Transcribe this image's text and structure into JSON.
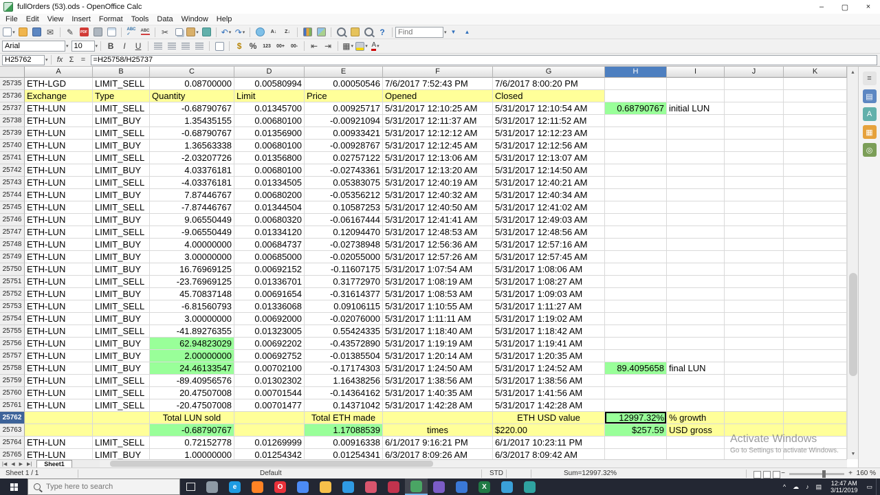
{
  "window": {
    "title": "fullOrders (53).ods - OpenOffice Calc"
  },
  "menubar": [
    "File",
    "Edit",
    "View",
    "Insert",
    "Format",
    "Tools",
    "Data",
    "Window",
    "Help"
  ],
  "standard_toolbar": {
    "find_placeholder": "Find"
  },
  "formatting_toolbar": {
    "font_name": "Arial",
    "font_size": "10"
  },
  "formula_bar": {
    "name_box": "H25762",
    "formula": "=H25758/H25737"
  },
  "colors": {
    "header_yellow": "#ffff99",
    "highlight_green": "#99ff99",
    "selected_header_blue": "#4d7fc0",
    "selection_border": "#000000",
    "taskbar": "#232733"
  },
  "sheet": {
    "columns": [
      "A",
      "B",
      "C",
      "D",
      "E",
      "F",
      "G",
      "H",
      "I",
      "J",
      "K"
    ],
    "selected_cell": {
      "row": "25762",
      "col": "H"
    },
    "left_rows": [
      "25736"
    ],
    "center_cells": [
      "25762:C",
      "25762:E",
      "25762:G",
      "25763:F"
    ],
    "green_cells": [
      "25737:H",
      "25756:C",
      "25757:C",
      "25758:C",
      "25758:H",
      "25762:H",
      "25763:C",
      "25763:E",
      "25763:H"
    ],
    "yellow": {
      "25736": "ABCDEFG",
      "25762": "ABCDEFGHIJK",
      "25763": "ABCDEFGHIJK"
    },
    "rows": [
      {
        "n": "25735",
        "c": [
          "ETH-LGD",
          "LIMIT_SELL",
          "0.08700000",
          "0.00580994",
          "0.00050546",
          "7/6/2017 7:52:43 PM",
          "7/6/2017 8:00:20 PM",
          "",
          ""
        ]
      },
      {
        "n": "25736",
        "c": [
          "Exchange",
          "Type",
          "Quantity",
          "Limit",
          "Price",
          "Opened",
          "Closed",
          "",
          ""
        ]
      },
      {
        "n": "25737",
        "c": [
          "ETH-LUN",
          "LIMIT_SELL",
          "-0.68790767",
          "0.01345700",
          "0.00925717",
          "5/31/2017 12:10:25 AM",
          "5/31/2017 12:10:54 AM",
          "0.68790767",
          "initial LUN"
        ]
      },
      {
        "n": "25738",
        "c": [
          "ETH-LUN",
          "LIMIT_BUY",
          "1.35435155",
          "0.00680100",
          "-0.00921094",
          "5/31/2017 12:11:37 AM",
          "5/31/2017 12:11:52 AM",
          "",
          ""
        ]
      },
      {
        "n": "25739",
        "c": [
          "ETH-LUN",
          "LIMIT_SELL",
          "-0.68790767",
          "0.01356900",
          "0.00933421",
          "5/31/2017 12:12:12 AM",
          "5/31/2017 12:12:23 AM",
          "",
          ""
        ]
      },
      {
        "n": "25740",
        "c": [
          "ETH-LUN",
          "LIMIT_BUY",
          "1.36563338",
          "0.00680100",
          "-0.00928767",
          "5/31/2017 12:12:45 AM",
          "5/31/2017 12:12:56 AM",
          "",
          ""
        ]
      },
      {
        "n": "25741",
        "c": [
          "ETH-LUN",
          "LIMIT_SELL",
          "-2.03207726",
          "0.01356800",
          "0.02757122",
          "5/31/2017 12:13:06 AM",
          "5/31/2017 12:13:07 AM",
          "",
          ""
        ]
      },
      {
        "n": "25742",
        "c": [
          "ETH-LUN",
          "LIMIT_BUY",
          "4.03376181",
          "0.00680100",
          "-0.02743361",
          "5/31/2017 12:13:20 AM",
          "5/31/2017 12:14:50 AM",
          "",
          ""
        ]
      },
      {
        "n": "25743",
        "c": [
          "ETH-LUN",
          "LIMIT_SELL",
          "-4.03376181",
          "0.01334505",
          "0.05383075",
          "5/31/2017 12:40:19 AM",
          "5/31/2017 12:40:21 AM",
          "",
          ""
        ]
      },
      {
        "n": "25744",
        "c": [
          "ETH-LUN",
          "LIMIT_BUY",
          "7.87446767",
          "0.00680200",
          "-0.05356212",
          "5/31/2017 12:40:32 AM",
          "5/31/2017 12:40:34 AM",
          "",
          ""
        ]
      },
      {
        "n": "25745",
        "c": [
          "ETH-LUN",
          "LIMIT_SELL",
          "-7.87446767",
          "0.01344504",
          "0.10587253",
          "5/31/2017 12:40:50 AM",
          "5/31/2017 12:41:02 AM",
          "",
          ""
        ]
      },
      {
        "n": "25746",
        "c": [
          "ETH-LUN",
          "LIMIT_BUY",
          "9.06550449",
          "0.00680320",
          "-0.06167444",
          "5/31/2017 12:41:41 AM",
          "5/31/2017 12:49:03 AM",
          "",
          ""
        ]
      },
      {
        "n": "25747",
        "c": [
          "ETH-LUN",
          "LIMIT_SELL",
          "-9.06550449",
          "0.01334120",
          "0.12094470",
          "5/31/2017 12:48:53 AM",
          "5/31/2017 12:48:56 AM",
          "",
          ""
        ]
      },
      {
        "n": "25748",
        "c": [
          "ETH-LUN",
          "LIMIT_BUY",
          "4.00000000",
          "0.00684737",
          "-0.02738948",
          "5/31/2017 12:56:36 AM",
          "5/31/2017 12:57:16 AM",
          "",
          ""
        ]
      },
      {
        "n": "25749",
        "c": [
          "ETH-LUN",
          "LIMIT_BUY",
          "3.00000000",
          "0.00685000",
          "-0.02055000",
          "5/31/2017 12:57:26 AM",
          "5/31/2017 12:57:45 AM",
          "",
          ""
        ]
      },
      {
        "n": "25750",
        "c": [
          "ETH-LUN",
          "LIMIT_BUY",
          "16.76969125",
          "0.00692152",
          "-0.11607175",
          "5/31/2017 1:07:54 AM",
          "5/31/2017 1:08:06 AM",
          "",
          ""
        ]
      },
      {
        "n": "25751",
        "c": [
          "ETH-LUN",
          "LIMIT_SELL",
          "-23.76969125",
          "0.01336701",
          "0.31772970",
          "5/31/2017 1:08:19 AM",
          "5/31/2017 1:08:27 AM",
          "",
          ""
        ]
      },
      {
        "n": "25752",
        "c": [
          "ETH-LUN",
          "LIMIT_BUY",
          "45.70837148",
          "0.00691654",
          "-0.31614377",
          "5/31/2017 1:08:53 AM",
          "5/31/2017 1:09:03 AM",
          "",
          ""
        ]
      },
      {
        "n": "25753",
        "c": [
          "ETH-LUN",
          "LIMIT_SELL",
          "-6.81560793",
          "0.01336068",
          "0.09106115",
          "5/31/2017 1:10:55 AM",
          "5/31/2017 1:11:27 AM",
          "",
          ""
        ]
      },
      {
        "n": "25754",
        "c": [
          "ETH-LUN",
          "LIMIT_BUY",
          "3.00000000",
          "0.00692000",
          "-0.02076000",
          "5/31/2017 1:11:11 AM",
          "5/31/2017 1:19:02 AM",
          "",
          ""
        ]
      },
      {
        "n": "25755",
        "c": [
          "ETH-LUN",
          "LIMIT_SELL",
          "-41.89276355",
          "0.01323005",
          "0.55424335",
          "5/31/2017 1:18:40 AM",
          "5/31/2017 1:18:42 AM",
          "",
          ""
        ]
      },
      {
        "n": "25756",
        "c": [
          "ETH-LUN",
          "LIMIT_BUY",
          "62.94823029",
          "0.00692202",
          "-0.43572890",
          "5/31/2017 1:19:19 AM",
          "5/31/2017 1:19:41 AM",
          "",
          ""
        ]
      },
      {
        "n": "25757",
        "c": [
          "ETH-LUN",
          "LIMIT_BUY",
          "2.00000000",
          "0.00692752",
          "-0.01385504",
          "5/31/2017 1:20:14 AM",
          "5/31/2017 1:20:35 AM",
          "",
          ""
        ]
      },
      {
        "n": "25758",
        "c": [
          "ETH-LUN",
          "LIMIT_BUY",
          "24.46133547",
          "0.00702100",
          "-0.17174303",
          "5/31/2017 1:24:50 AM",
          "5/31/2017 1:24:52 AM",
          "89.4095658",
          "final LUN"
        ]
      },
      {
        "n": "25759",
        "c": [
          "ETH-LUN",
          "LIMIT_SELL",
          "-89.40956576",
          "0.01302302",
          "1.16438256",
          "5/31/2017 1:38:56 AM",
          "5/31/2017 1:38:56 AM",
          "",
          ""
        ]
      },
      {
        "n": "25760",
        "c": [
          "ETH-LUN",
          "LIMIT_SELL",
          "20.47507008",
          "0.00701544",
          "-0.14364162",
          "5/31/2017 1:40:35 AM",
          "5/31/2017 1:41:56 AM",
          "",
          ""
        ]
      },
      {
        "n": "25761",
        "c": [
          "ETH-LUN",
          "LIMIT_SELL",
          "-20.47507008",
          "0.00701477",
          "0.14371042",
          "5/31/2017 1:42:28 AM",
          "5/31/2017 1:42:28 AM",
          "",
          ""
        ]
      },
      {
        "n": "25762",
        "c": [
          "",
          "",
          "Total LUN sold",
          "",
          "Total ETH made",
          "",
          "ETH USD value",
          "12997.32%",
          "% growth"
        ]
      },
      {
        "n": "25763",
        "c": [
          "",
          "",
          "-0.68790767",
          "",
          "1.17088539",
          "times",
          "$220.00",
          "$257.59",
          "USD gross"
        ]
      },
      {
        "n": "25764",
        "c": [
          "ETH-LUN",
          "LIMIT_SELL",
          "0.72152778",
          "0.01269999",
          "0.00916338",
          "6/1/2017 9:16:21 PM",
          "6/1/2017 10:23:11 PM",
          "",
          ""
        ]
      },
      {
        "n": "25765",
        "c": [
          "ETH-LUN",
          "LIMIT_BUY",
          "1.00000000",
          "0.01254342",
          "0.01254341",
          "6/3/2017 8:09:26 AM",
          "6/3/2017 8:09:42 AM",
          "",
          ""
        ]
      }
    ]
  },
  "tabs": {
    "sheet_name": "Sheet1"
  },
  "status_bar": {
    "sheet_info": "Sheet 1 / 1",
    "page_style": "Default",
    "mode": "STD",
    "sum": "Sum=12997.32%",
    "zoom": "160 %"
  },
  "watermark": {
    "line1": "Activate Windows",
    "line2": "Go to Settings to activate Windows."
  },
  "taskbar": {
    "search_placeholder": "Type here to search",
    "time": "12:47 AM",
    "date": "3/11/2019",
    "apps": [
      {
        "id": "people",
        "color": "#8e9aa5",
        "glyph": ""
      },
      {
        "id": "edge",
        "color": "#1e9be2",
        "glyph": "e"
      },
      {
        "id": "firefox",
        "color": "#ff8324",
        "glyph": ""
      },
      {
        "id": "opera",
        "color": "#e8313a",
        "glyph": "O"
      },
      {
        "id": "chrome",
        "color": "#4c8bf5",
        "glyph": ""
      },
      {
        "id": "file-explorer",
        "color": "#f7c04a",
        "glyph": ""
      },
      {
        "id": "store",
        "color": "#2f9ae3",
        "glyph": ""
      },
      {
        "id": "photos",
        "color": "#d9556d",
        "glyph": ""
      },
      {
        "id": "app-red",
        "color": "#c2334d",
        "glyph": ""
      },
      {
        "id": "openoffice-calc",
        "color": "#4aa564",
        "glyph": "",
        "active": true
      },
      {
        "id": "app-purple",
        "color": "#7b5cc6",
        "glyph": ""
      },
      {
        "id": "app-blue",
        "color": "#3a78d6",
        "glyph": ""
      },
      {
        "id": "excel",
        "color": "#1f7a45",
        "glyph": "X"
      },
      {
        "id": "mail",
        "color": "#3aa0d8",
        "glyph": ""
      },
      {
        "id": "app-teal",
        "color": "#2fa3a0",
        "glyph": ""
      }
    ]
  }
}
